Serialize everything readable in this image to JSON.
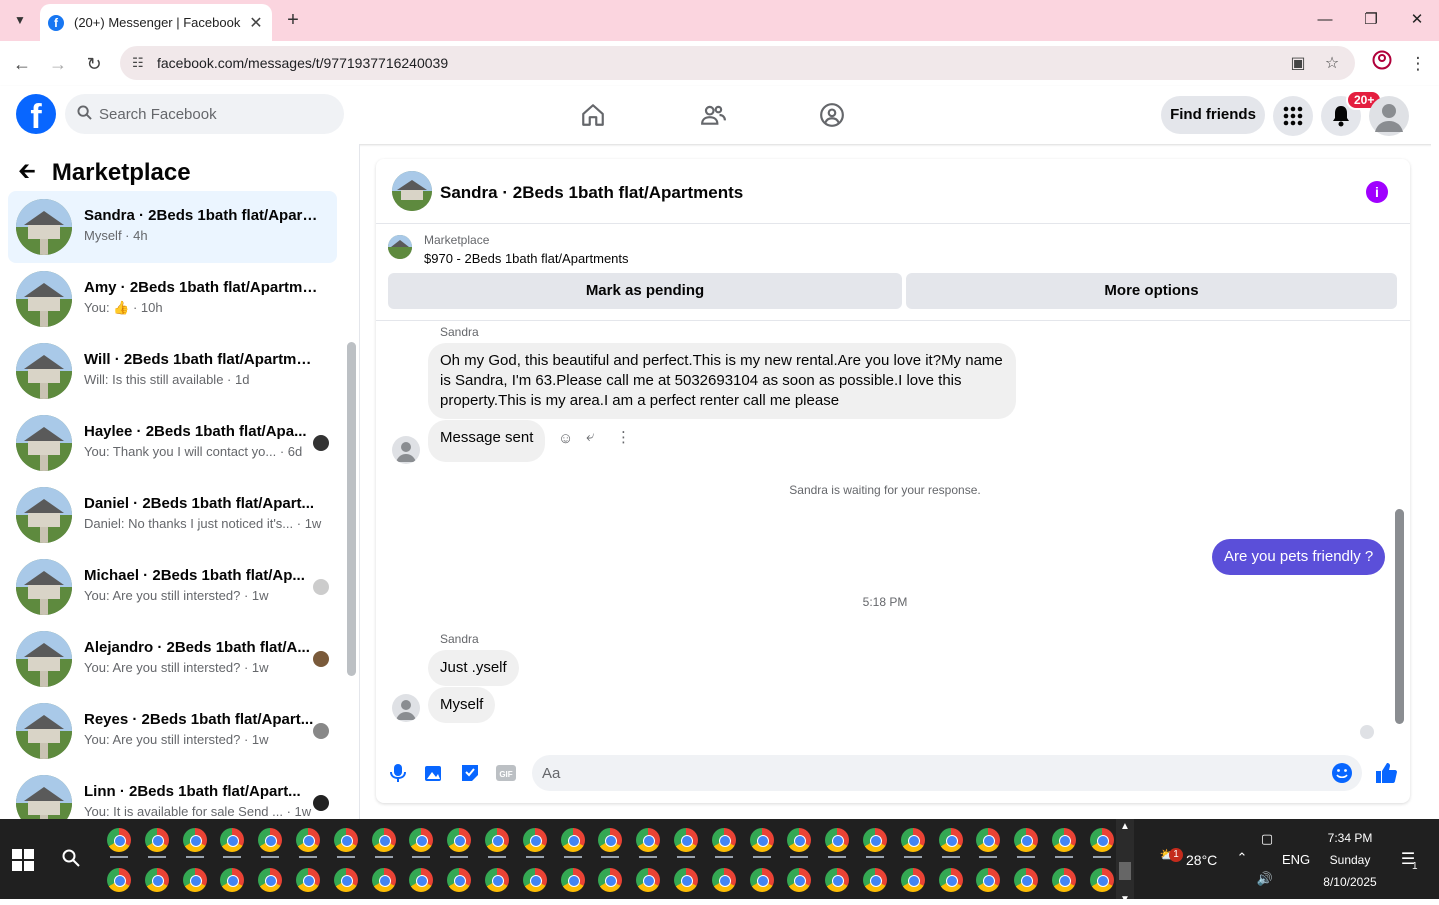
{
  "browser": {
    "tab_title": "(20+) Messenger | Facebook",
    "url": "facebook.com/messages/t/9771937716240039"
  },
  "facebook": {
    "search_placeholder": "Search Facebook",
    "find_friends": "Find friends",
    "notif_badge": "20+"
  },
  "sidebar": {
    "title": "Marketplace",
    "conversations": [
      {
        "name": "Sandra · 2Beds 1bath flat/Apart...",
        "preview": "Myself · 4h",
        "selected": true
      },
      {
        "name": "Amy · 2Beds 1bath flat/Apartme...",
        "preview": "You: 👍 · 10h"
      },
      {
        "name": "Will · 2Beds 1bath flat/Apartments",
        "preview": "Will: Is this still available · 1d"
      },
      {
        "name": "Haylee · 2Beds 1bath flat/Apa...",
        "preview": "You: Thank you I will contact yo...  · 6d"
      },
      {
        "name": "Daniel · 2Beds 1bath flat/Apart...",
        "preview": "Daniel: No thanks I just noticed it's... · 1w"
      },
      {
        "name": "Michael · 2Beds 1bath flat/Ap...",
        "preview": "You: Are you still intersted? · 1w"
      },
      {
        "name": "Alejandro · 2Beds 1bath flat/A...",
        "preview": "You: Are you still intersted? · 1w"
      },
      {
        "name": "Reyes · 2Beds 1bath flat/Apart...",
        "preview": "You: Are you still intersted? · 1w"
      },
      {
        "name": "Linn · 2Beds 1bath flat/Apart...",
        "preview": "You: It is available for sale Send ... · 1w"
      }
    ]
  },
  "chat": {
    "title": "Sandra · 2Beds 1bath flat/Apartments",
    "listing_label": "Marketplace",
    "listing": "$970 - 2Beds 1bath flat/Apartments",
    "mark_pending": "Mark as pending",
    "more_options": "More options",
    "sender1": "Sandra",
    "msg1": "Oh my God, this beautiful and perfect.This is my new rental.Are you love it?My name is Sandra, I'm 63.Please call me at 5032693104 as soon as possible.I love this property.This is my area.I am a perfect renter call me please",
    "msg2": "Message sent",
    "waiting": "Sandra is waiting for your response.",
    "my_msg": "Are you pets friendly ?",
    "time": "5:18 PM",
    "sender2": "Sandra",
    "msg3": "Just .yself",
    "msg4": "Myself",
    "composer_placeholder": "Aa"
  },
  "taskbar": {
    "weather": "28°C",
    "weather_badge": "1",
    "lang": "ENG",
    "time": "7:34 PM",
    "day": "Sunday",
    "date": "8/10/2025",
    "notif_count": "1"
  },
  "colors": {
    "fb_blue": "#0866ff",
    "messenger_purple": "#5b4fd9",
    "tab_pink": "#fbd5df"
  }
}
